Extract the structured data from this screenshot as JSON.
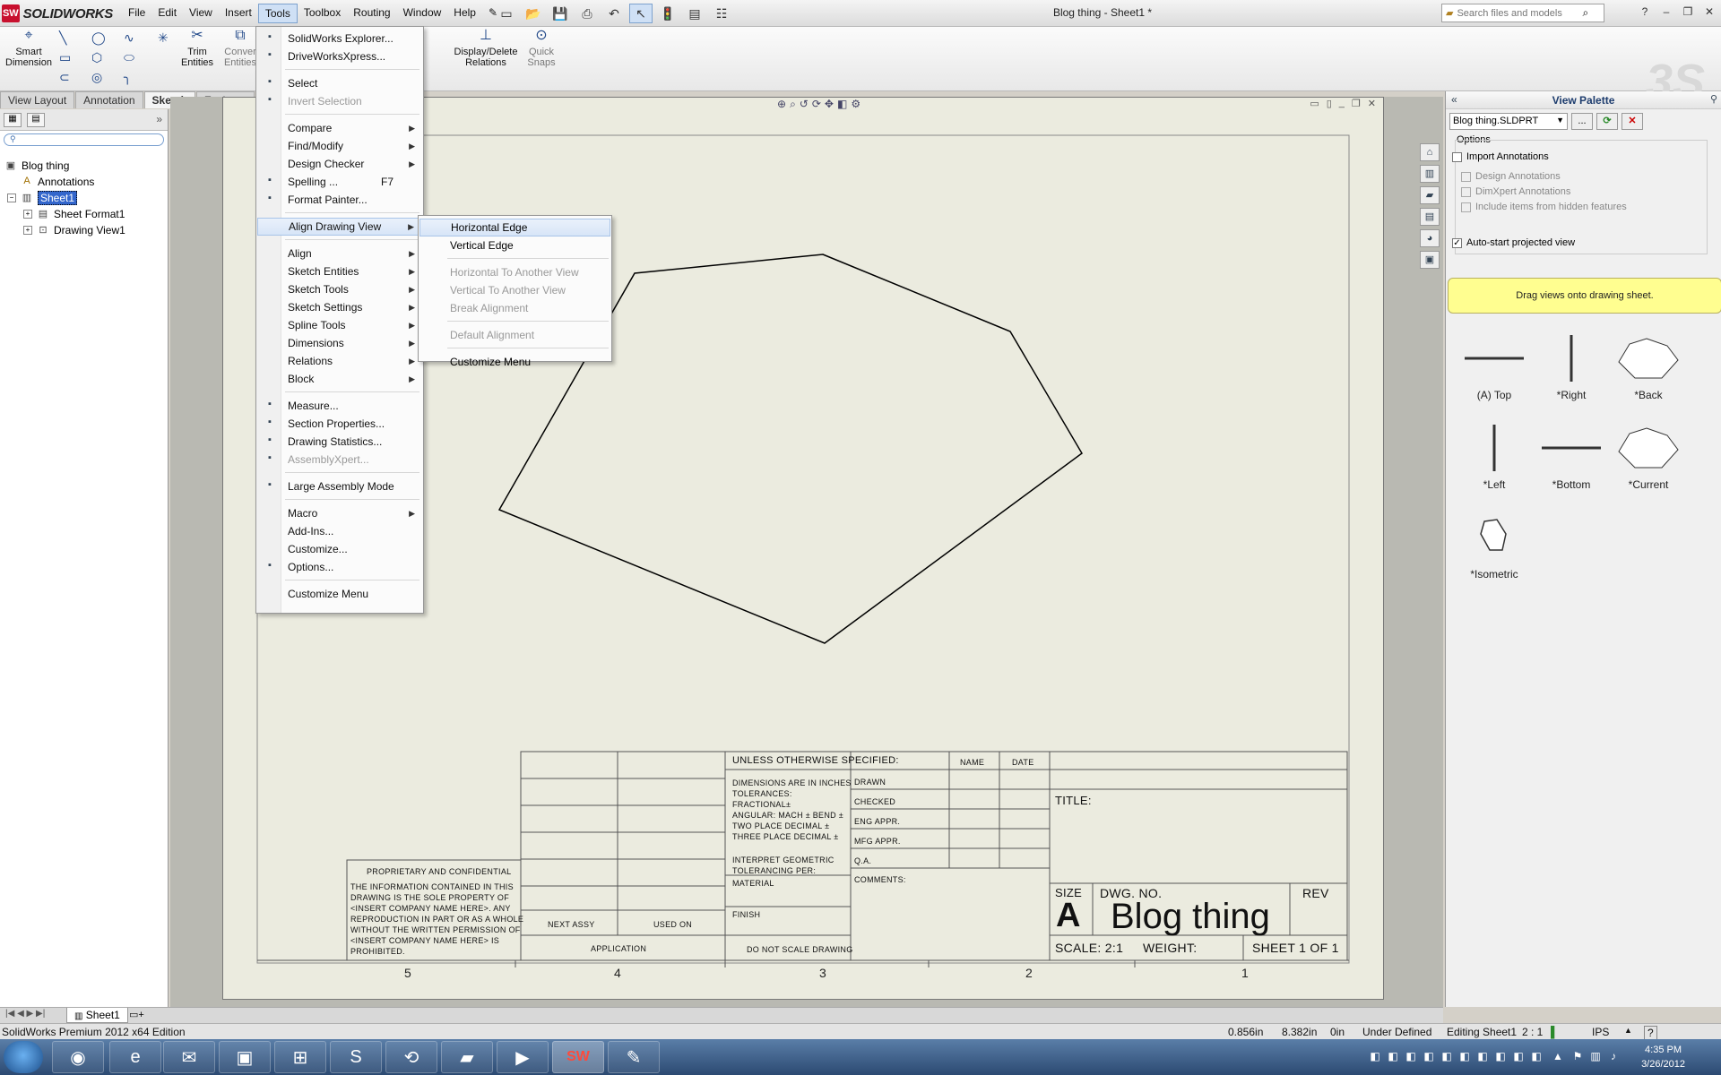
{
  "app": {
    "logo_text": "SOLIDWORKS",
    "logo_mark": "SW",
    "doc_title": "Blog thing - Sheet1 *"
  },
  "menubar": [
    "File",
    "Edit",
    "View",
    "Insert",
    "Tools",
    "Toolbox",
    "Routing",
    "Window",
    "Help"
  ],
  "search": {
    "placeholder": "Search files and models"
  },
  "command_manager": {
    "smart_dimension": "Smart Dimension",
    "trim_entities": "Trim Entities",
    "convert_entities": "Conver Entities",
    "display_delete_relations": "Display/Delete Relations",
    "quick_snaps": "Quick Snaps"
  },
  "tabs": [
    "View Layout",
    "Annotation",
    "Sketch",
    "Evaluate"
  ],
  "active_tab": "Sketch",
  "tree": {
    "root": "Blog thing",
    "annotations": "Annotations",
    "sheet": "Sheet1",
    "sheet_format": "Sheet Format1",
    "drawing_view": "Drawing View1"
  },
  "tools_menu": {
    "items": [
      {
        "label": "SolidWorks Explorer...",
        "icon": "explorer-icon"
      },
      {
        "label": "DriveWorksXpress...",
        "icon": "driveworks-icon"
      },
      {
        "label": "Select",
        "icon": "select-arrow-icon"
      },
      {
        "label": "Invert Selection",
        "icon": "invert-selection-icon",
        "disabled": true
      },
      {
        "label": "Compare",
        "submenu": true
      },
      {
        "label": "Find/Modify",
        "submenu": true
      },
      {
        "label": "Design Checker",
        "submenu": true
      },
      {
        "label": "Spelling ...",
        "shortcut": "F7",
        "icon": "spelling-icon"
      },
      {
        "label": "Format Painter...",
        "icon": "format-painter-icon"
      },
      {
        "label": "Align Drawing View",
        "submenu": true,
        "highlighted": true
      },
      {
        "label": "Align",
        "submenu": true
      },
      {
        "label": "Sketch Entities",
        "submenu": true
      },
      {
        "label": "Sketch Tools",
        "submenu": true
      },
      {
        "label": "Sketch Settings",
        "submenu": true
      },
      {
        "label": "Spline Tools",
        "submenu": true
      },
      {
        "label": "Dimensions",
        "submenu": true
      },
      {
        "label": "Relations",
        "submenu": true
      },
      {
        "label": "Block",
        "submenu": true
      },
      {
        "label": "Measure...",
        "icon": "measure-icon"
      },
      {
        "label": "Section Properties...",
        "icon": "section-properties-icon"
      },
      {
        "label": "Drawing Statistics...",
        "icon": "drawing-statistics-icon"
      },
      {
        "label": "AssemblyXpert...",
        "icon": "assemblyxpert-icon",
        "disabled": true
      },
      {
        "label": "Large Assembly Mode",
        "icon": "large-assembly-icon"
      },
      {
        "label": "Macro",
        "submenu": true
      },
      {
        "label": "Add-Ins..."
      },
      {
        "label": "Customize..."
      },
      {
        "label": "Options...",
        "icon": "options-icon"
      },
      {
        "label": "Customize Menu"
      }
    ]
  },
  "align_submenu": {
    "items": [
      {
        "label": "Horizontal Edge",
        "highlighted": true
      },
      {
        "label": "Vertical Edge"
      },
      {
        "label": "Horizontal To Another View",
        "disabled": true
      },
      {
        "label": "Vertical To Another View",
        "disabled": true
      },
      {
        "label": "Break Alignment",
        "disabled": true
      },
      {
        "label": "Default Alignment",
        "disabled": true
      },
      {
        "label": "Customize Menu"
      }
    ]
  },
  "title_block": {
    "unless": "UNLESS OTHERWISE SPECIFIED:",
    "name": "NAME",
    "date": "DATE",
    "dims": "DIMENSIONS ARE IN INCHES",
    "tolerances": "TOLERANCES:",
    "fractional": "FRACTIONAL±",
    "angular": "ANGULAR: MACH ±    BEND ±",
    "two_place": "TWO PLACE DECIMAL    ±",
    "three_place": "THREE PLACE DECIMAL  ±",
    "interpret": "INTERPRET GEOMETRIC",
    "tolerancing": "TOLERANCING PER:",
    "material": "MATERIAL",
    "finish": "FINISH",
    "do_not_scale": "DO NOT SCALE DRAWING",
    "drawn": "DRAWN",
    "checked": "CHECKED",
    "eng_appr": "ENG APPR.",
    "mfg_appr": "MFG APPR.",
    "qa": "Q.A.",
    "comments": "COMMENTS:",
    "title_label": "TITLE:",
    "size_label": "SIZE",
    "size_value": "A",
    "dwg_no_label": "DWG. NO.",
    "dwg_no_value": "Blog thing",
    "rev_label": "REV",
    "scale": "SCALE: 2:1",
    "weight": "WEIGHT:",
    "sheet_of": "SHEET 1 OF 1",
    "next_assy": "NEXT ASSY",
    "used_on": "USED ON",
    "application": "APPLICATION",
    "proprietary_title": "PROPRIETARY AND CONFIDENTIAL",
    "proprietary_lines": [
      "THE INFORMATION CONTAINED IN THIS",
      "DRAWING IS THE SOLE PROPERTY OF",
      "<INSERT COMPANY NAME HERE>. ANY",
      "REPRODUCTION IN PART OR AS A WHOLE",
      "WITHOUT THE WRITTEN PERMISSION OF",
      "<INSERT COMPANY NAME HERE> IS",
      "PROHIBITED."
    ]
  },
  "zones": [
    "5",
    "4",
    "3",
    "2",
    "1"
  ],
  "view_palette": {
    "title": "View Palette",
    "file": "Blog thing.SLDPRT",
    "browse": "...",
    "options_label": "Options",
    "import_annotations": "Import Annotations",
    "design_annotations": "Design Annotations",
    "dimxpert_annotations": "DimXpert Annotations",
    "hidden_features": "Include items from hidden features",
    "auto_start": "Auto-start projected view",
    "drag_hint": "Drag views onto drawing sheet.",
    "views": [
      "(A) Top",
      "*Right",
      "*Back",
      "*Left",
      "*Bottom",
      "*Current",
      "*Isometric"
    ]
  },
  "sheet_tab": "Sheet1",
  "status": {
    "edition": "SolidWorks Premium 2012 x64 Edition",
    "x": "0.856in",
    "y": "8.382in",
    "z": "0in",
    "state": "Under Defined",
    "editing": "Editing Sheet1",
    "scale": "2 : 1",
    "units": "IPS"
  },
  "clock": {
    "time": "4:35 PM",
    "date": "3/26/2012"
  }
}
